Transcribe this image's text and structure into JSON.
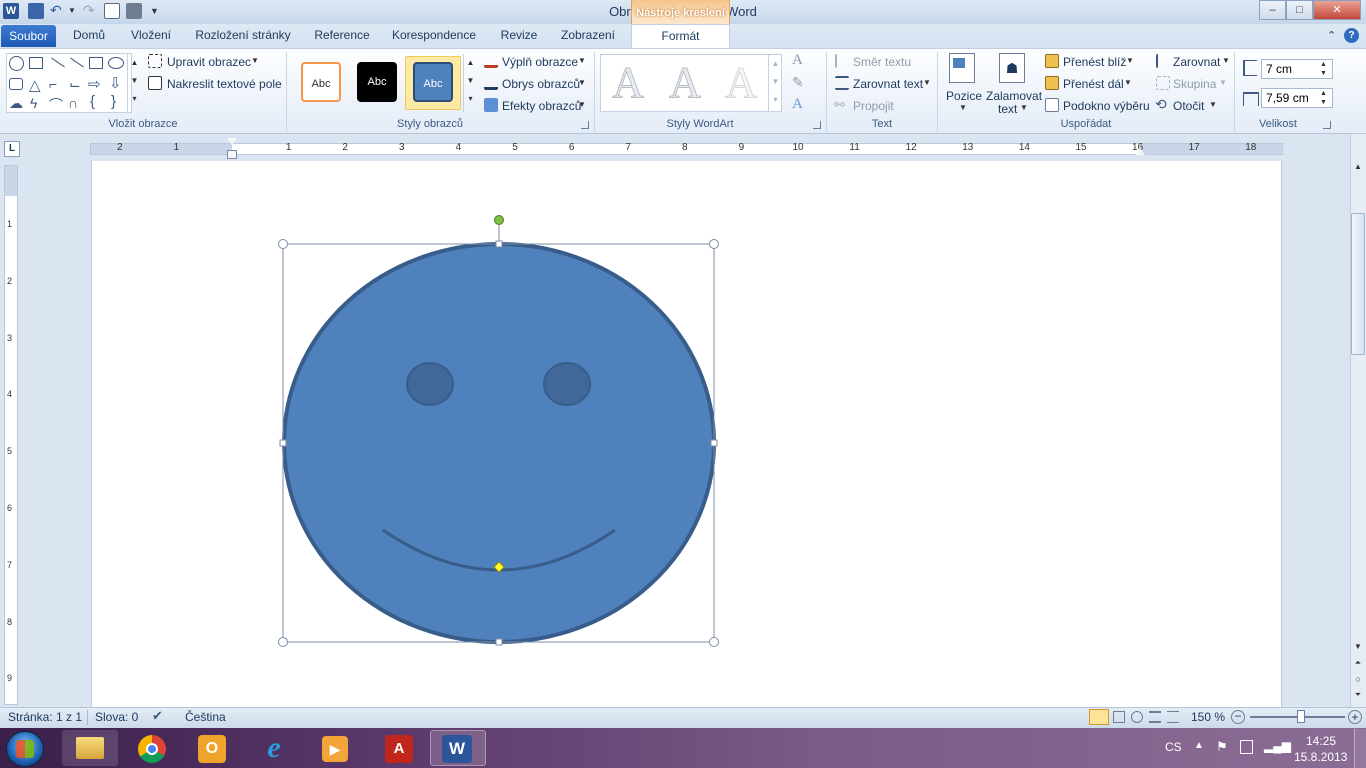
{
  "app": {
    "title": "Obrazek  -  Microsoft Word",
    "contextual_tab": "Nástroje kreslení"
  },
  "window_buttons": {
    "minimize": "–",
    "maximize": "□",
    "close": "✕"
  },
  "tabs": [
    {
      "label": "Soubor"
    },
    {
      "label": "Domů"
    },
    {
      "label": "Vložení"
    },
    {
      "label": "Rozložení stránky"
    },
    {
      "label": "Reference"
    },
    {
      "label": "Korespondence"
    },
    {
      "label": "Revize"
    },
    {
      "label": "Zobrazení"
    },
    {
      "label": "Formát"
    }
  ],
  "ribbon": {
    "insert_shapes": {
      "edit_shape": "Upravit obrazec",
      "draw_textbox": "Nakreslit textové pole",
      "label": "Vložit obrazce"
    },
    "shape_styles": {
      "thumb1": "Abc",
      "thumb2": "Abc",
      "thumb3": "Abc",
      "fill": "Výplň obrazce",
      "outline": "Obrys obrazců",
      "effects": "Efekty obrazců",
      "label": "Styly obrazců"
    },
    "wordart": {
      "letter": "A",
      "label": "Styly WordArt"
    },
    "text": {
      "direction": "Směr textu",
      "align": "Zarovnat text",
      "link": "Propojit",
      "label": "Text"
    },
    "arrange": {
      "position": "Pozice",
      "wrap_line1": "Zalamovat",
      "wrap_line2": "text",
      "bring_forward": "Přenést blíž",
      "send_backward": "Přenést dál",
      "selection_pane": "Podokno výběru",
      "align": "Zarovnat",
      "group": "Skupina",
      "rotate": "Otočit",
      "label": "Uspořádat"
    },
    "size": {
      "height": "7 cm",
      "width": "7,59 cm",
      "label": "Velikost"
    }
  },
  "ruler": {
    "h_left_numbers": [
      "2",
      "1"
    ],
    "h_numbers": [
      "1",
      "2",
      "3",
      "4",
      "5",
      "6",
      "7",
      "8",
      "9",
      "10",
      "11",
      "12",
      "13",
      "14",
      "15",
      "16",
      "17",
      "18"
    ],
    "v_numbers": [
      "1",
      "2",
      "3",
      "4",
      "5",
      "6",
      "7",
      "8",
      "9"
    ]
  },
  "statusbar": {
    "page": "Stránka: 1 z 1",
    "words": "Slova: 0",
    "language": "Čeština",
    "zoom": "150 %"
  },
  "taskbar": {
    "language": "CS",
    "time": "14:25",
    "date": "15.8.2013"
  },
  "colors": {
    "face_fill": "#4f81bd",
    "face_stroke": "#385d8a",
    "eye_fill": "#42689a",
    "selection_handle": "#ffffff",
    "rotate_handle": "#7ec242",
    "adjust_handle": "#ffff33"
  }
}
